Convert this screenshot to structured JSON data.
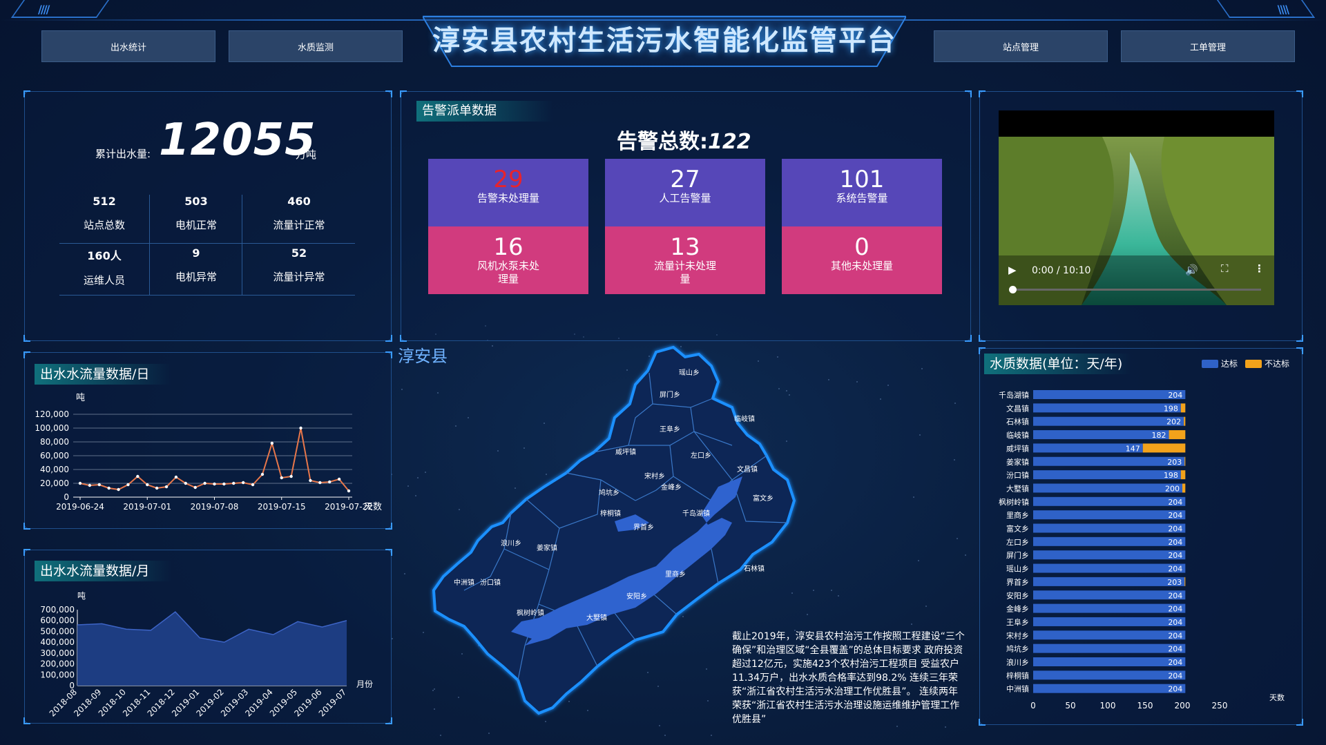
{
  "header": {
    "title": "淳安县农村生活污水智能化监管平台",
    "nav_left": [
      "出水统计",
      "水质监测"
    ],
    "nav_right": [
      "站点管理",
      "工单管理"
    ]
  },
  "summary": {
    "total_label": "累计出水量:",
    "total_value": "12055",
    "total_unit": "万吨",
    "stats": [
      {
        "value": "512",
        "label": "站点总数"
      },
      {
        "value": "503",
        "label": "电机正常"
      },
      {
        "value": "460",
        "label": "流量计正常"
      },
      {
        "value": "160人",
        "label": "运维人员"
      },
      {
        "value": "9",
        "label": "电机异常"
      },
      {
        "value": "52",
        "label": "流量计异常"
      }
    ]
  },
  "alarm": {
    "title": "告警派单数据",
    "total_label": "告警总数:",
    "total_value": "122",
    "boxes": [
      {
        "value": "29",
        "label": "告警未处理量",
        "color": "#e8232c"
      },
      {
        "value": "27",
        "label": "人工告警量",
        "color": "#ffffff"
      },
      {
        "value": "101",
        "label": "系统告警量",
        "color": "#ffffff"
      },
      {
        "value": "16",
        "label": "风机水泵未处理量",
        "color": "#ffffff"
      },
      {
        "value": "13",
        "label": "流量计未处理量",
        "color": "#ffffff"
      },
      {
        "value": "0",
        "label": "其他未处理量",
        "color": "#ffffff"
      }
    ]
  },
  "video": {
    "time": "0:00 / 10:10"
  },
  "map": {
    "name": "淳安县",
    "towns": [
      "瑶山乡",
      "屏门乡",
      "临岐镇",
      "王阜乡",
      "威坪镇",
      "左口乡",
      "文昌镇",
      "宋村乡",
      "金峰乡",
      "鸠坑乡",
      "梓桐镇",
      "千岛湖镇",
      "富文乡",
      "界首乡",
      "浪川乡",
      "姜家镇",
      "中洲镇",
      "汾口镇",
      "里商乡",
      "石林镇",
      "安阳乡",
      "枫树岭镇",
      "大墅镇"
    ]
  },
  "description": "截止2019年，淳安县农村治污工作按照工程建设“三个确保”和治理区域“全县覆盖”的总体目标要求 政府投资超过12亿元，实施423个农村治污工程项目 受益农户11.34万户，出水水质合格率达到98.2% 连续三年荣获“浙江省农村生活污水治理工作优胜县”。 连续两年荣获“浙江省农村生活污水治理设施运维维护管理工作优胜县”",
  "chart_data": [
    {
      "type": "line",
      "title": "出水水流量数据/日",
      "xlabel": "天数",
      "ylabel": "吨",
      "ylim": [
        0,
        120000
      ],
      "yticks": [
        "0",
        "20,000",
        "40,000",
        "60,000",
        "80,000",
        "100,000",
        "120,000"
      ],
      "xtick_labels": [
        "2019-06-24",
        "2019-07-01",
        "2019-07-08",
        "2019-07-15",
        "2019-07-22"
      ],
      "values": [
        20000,
        17000,
        18000,
        13000,
        11000,
        18000,
        30000,
        18000,
        13000,
        15000,
        29000,
        20000,
        14000,
        20000,
        19000,
        19000,
        20000,
        21000,
        18000,
        33000,
        78000,
        28000,
        30000,
        100000,
        24000,
        21000,
        22000,
        26000,
        9000
      ],
      "color": "#e8774a"
    },
    {
      "type": "area",
      "title": "出水水流量数据/月",
      "xlabel": "月份",
      "ylabel": "吨",
      "ylim": [
        0,
        700000
      ],
      "yticks": [
        "0",
        "100,000",
        "200,000",
        "300,000",
        "400,000",
        "500,000",
        "600,000",
        "700,000"
      ],
      "categories": [
        "2018-08",
        "2018-09",
        "2018-10",
        "2018-11",
        "2018-12",
        "2019-01",
        "2019-02",
        "2019-03",
        "2019-04",
        "2019-05",
        "2019-06",
        "2019-07"
      ],
      "values": [
        560000,
        570000,
        520000,
        510000,
        680000,
        440000,
        400000,
        520000,
        470000,
        590000,
        540000,
        600000
      ],
      "color": "#1f3f86"
    },
    {
      "type": "bar",
      "orientation": "horizontal",
      "stacked": true,
      "title": "水质数据(单位：天/年)",
      "xlabel": "天数",
      "xlim": [
        0,
        250
      ],
      "xticks": [
        "0",
        "50",
        "100",
        "150",
        "200",
        "250"
      ],
      "legend": "top-right",
      "categories": [
        "千岛湖镇",
        "文昌镇",
        "石林镇",
        "临岐镇",
        "威坪镇",
        "姜家镇",
        "汾口镇",
        "大墅镇",
        "枫树岭镇",
        "里商乡",
        "富文乡",
        "左口乡",
        "屏门乡",
        "瑶山乡",
        "界首乡",
        "安阳乡",
        "金峰乡",
        "王阜乡",
        "宋村乡",
        "鸠坑乡",
        "浪川乡",
        "梓桐镇",
        "中洲镇"
      ],
      "series": [
        {
          "name": "达标",
          "color": "#2f62c8",
          "values": [
            204,
            198,
            202,
            182,
            147,
            203,
            198,
            200,
            204,
            204,
            204,
            204,
            204,
            204,
            203,
            204,
            204,
            204,
            204,
            204,
            204,
            204,
            204
          ]
        },
        {
          "name": "不达标",
          "color": "#f2a21b",
          "values": [
            0,
            6,
            2,
            22,
            57,
            1,
            6,
            4,
            0,
            0,
            0,
            0,
            0,
            0,
            1,
            0,
            0,
            0,
            0,
            0,
            0,
            0,
            0
          ]
        }
      ]
    }
  ]
}
